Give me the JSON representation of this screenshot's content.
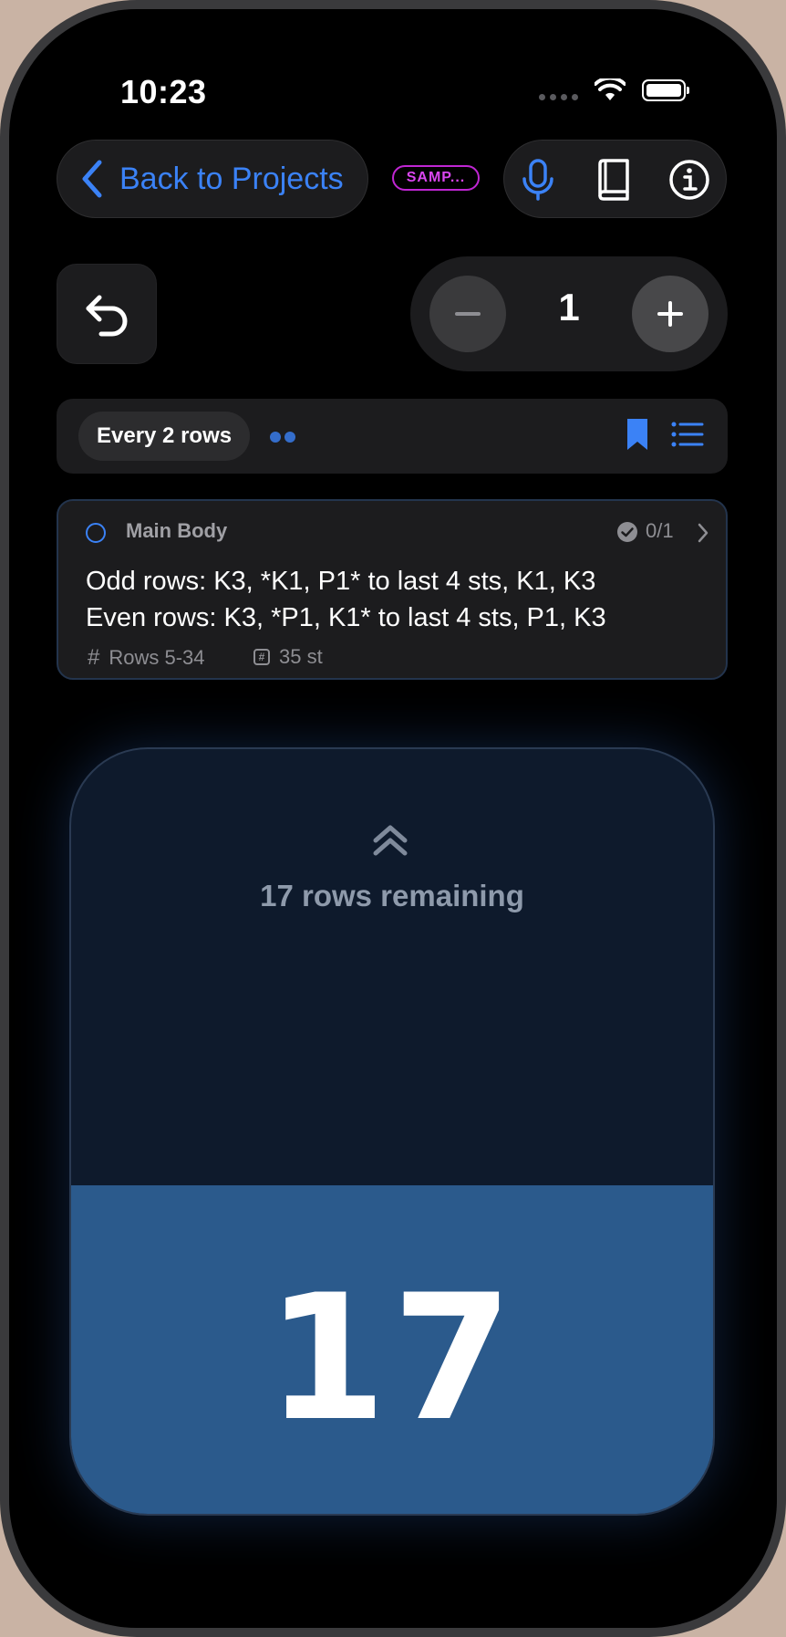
{
  "status_bar": {
    "time": "10:23"
  },
  "header": {
    "back_label": "Back to Projects",
    "badge_label": "SAMP..."
  },
  "counter_controls": {
    "step_value": "1"
  },
  "repeat_bar": {
    "chip_label": "Every 2 rows",
    "pager_count": 2
  },
  "section": {
    "title": "Main Body",
    "progress": "0/1",
    "odd_rows": "Odd rows: K3, *K1, P1* to last 4 sts, K1, K3",
    "even_rows": "Even rows: K3, *P1, K1* to last 4 sts, P1, K3",
    "rows_range": "Rows 5-34",
    "stitch_count": "35 st"
  },
  "row_counter": {
    "remaining_text": "17 rows remaining",
    "current_row": "17",
    "progress_fraction": 0.43,
    "fill_color": "#2b5a8c"
  },
  "colors": {
    "accent": "#3b82f6",
    "badge": "#d946ef",
    "background": "#000000"
  }
}
